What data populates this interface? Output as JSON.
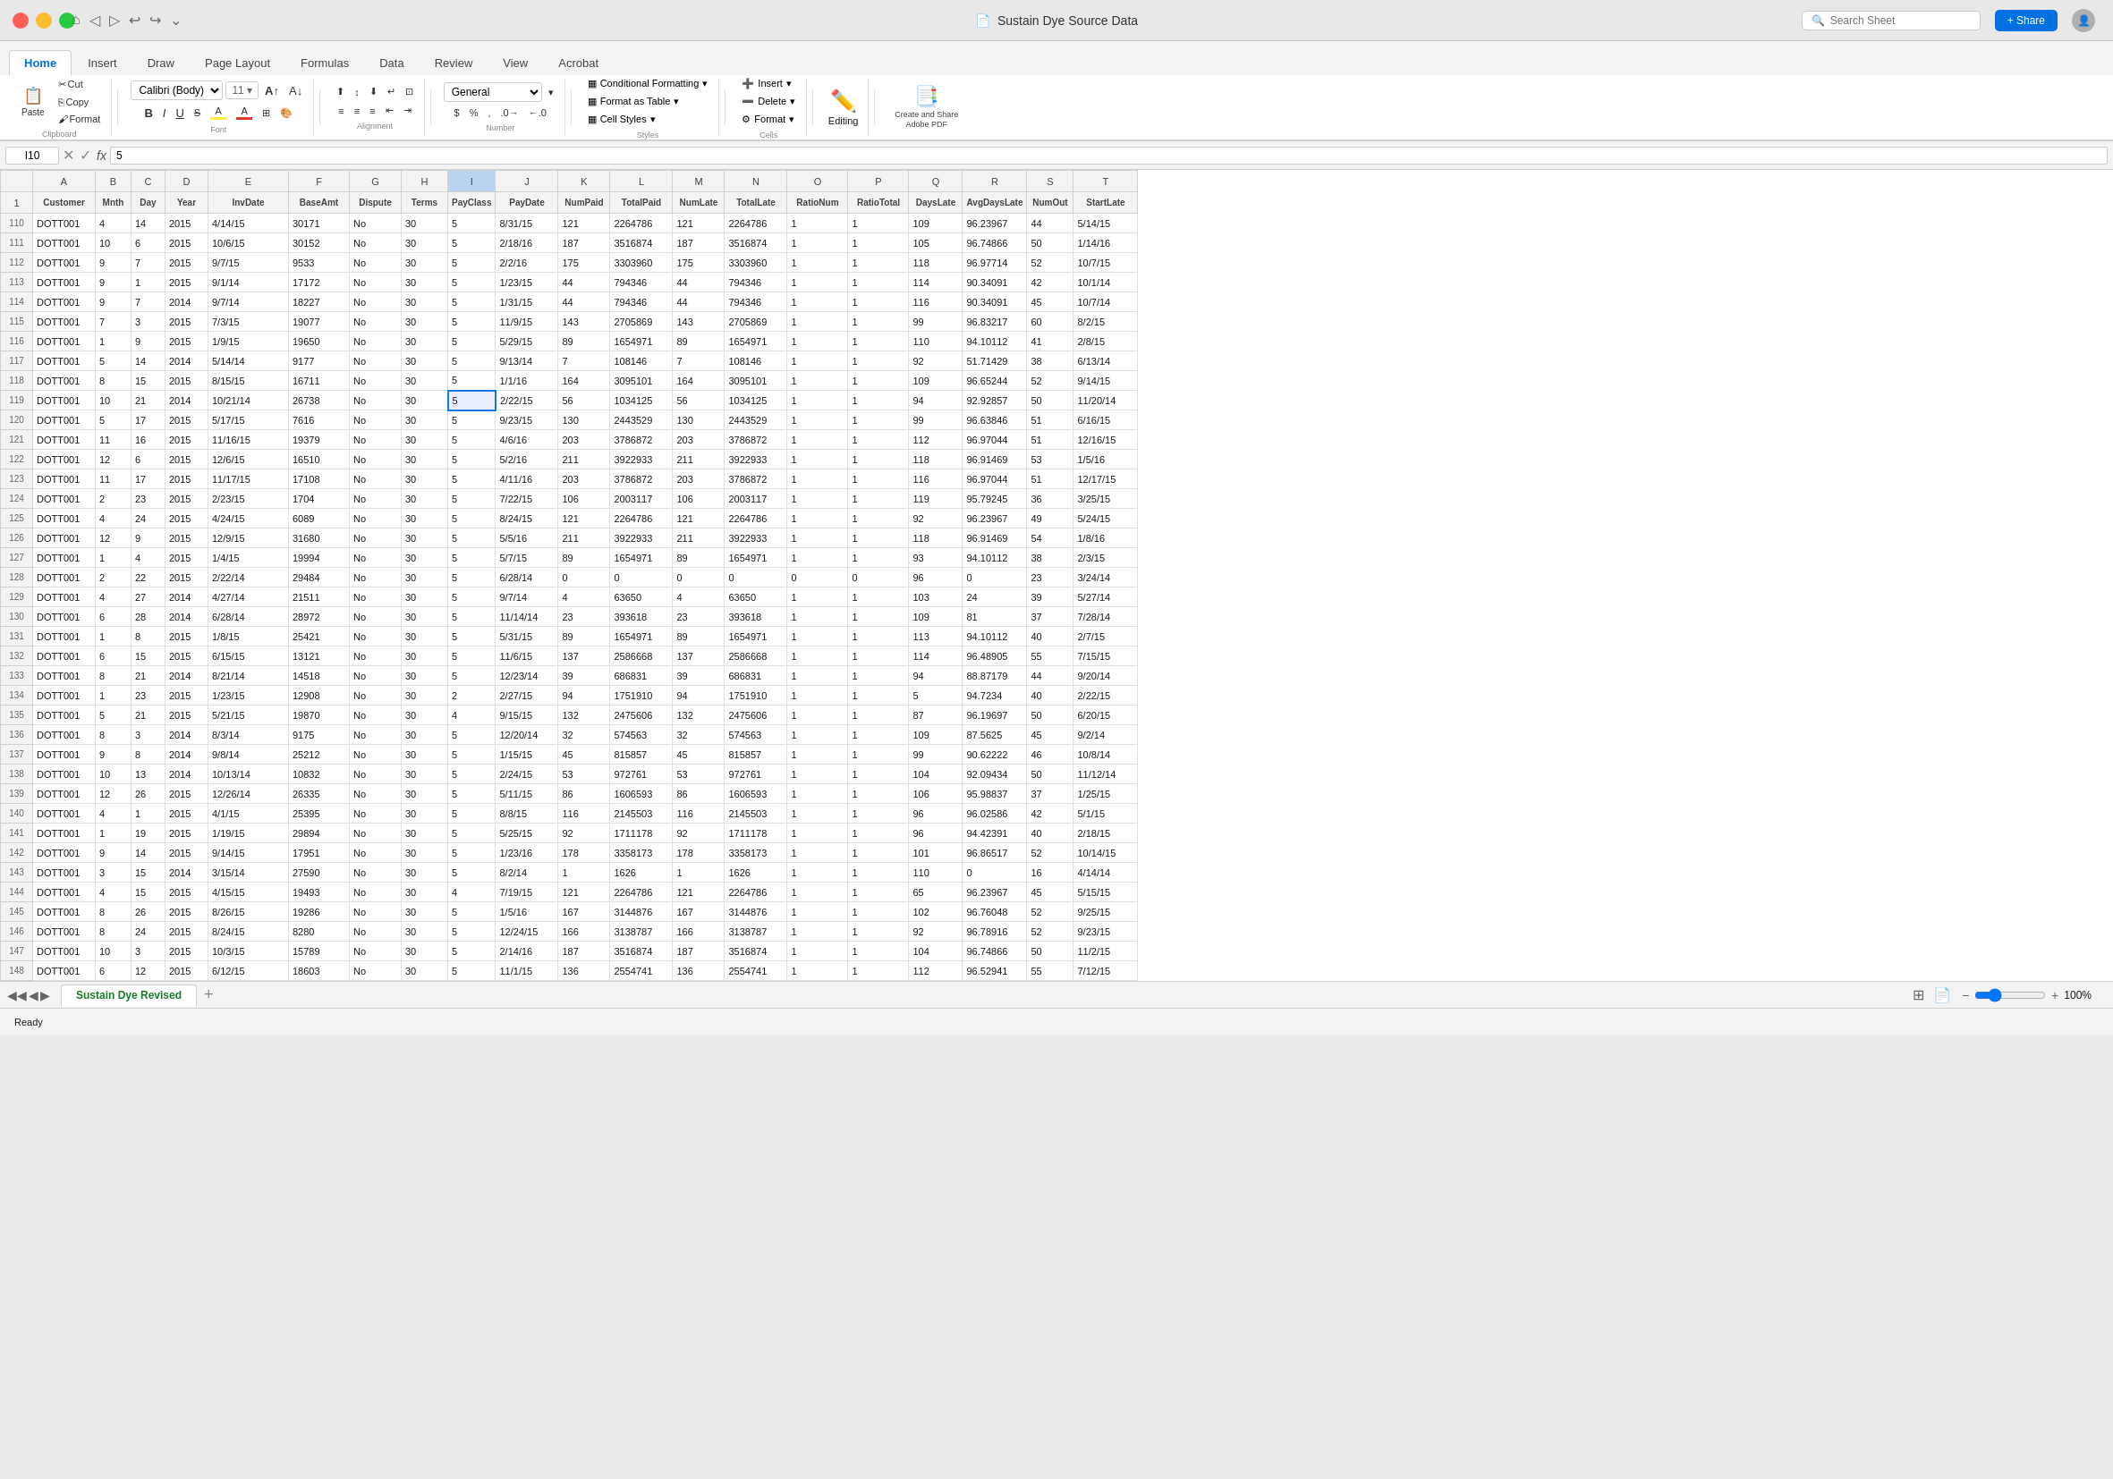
{
  "titlebar": {
    "title": "Sustain Dye Source Data",
    "file_icon": "📄"
  },
  "search": {
    "placeholder": "Search Sheet"
  },
  "share": {
    "label": "+ Share"
  },
  "tabs": [
    "Home",
    "Insert",
    "Draw",
    "Page Layout",
    "Formulas",
    "Data",
    "Review",
    "View",
    "Acrobat"
  ],
  "active_tab": "Home",
  "ribbon": {
    "clipboard": {
      "paste": "Paste",
      "cut_label": "✂",
      "copy_label": "⎘",
      "format_label": "🖌"
    },
    "font": {
      "name": "Calibri (Body)",
      "size": "11",
      "bold": "B",
      "italic": "I",
      "underline": "U"
    },
    "alignment": {
      "labels": [
        "≡",
        "≡",
        "≡",
        "⊞",
        "⊞",
        "⊞"
      ]
    },
    "number": {
      "format": "General"
    },
    "styles": {
      "conditional": "Conditional Formatting",
      "format_table": "Format as Table",
      "cell_styles": "Cell Styles"
    },
    "cells": {
      "insert": "Insert",
      "delete": "Delete",
      "format": "Format"
    },
    "editing_label": "Editing",
    "adobe_label": "Create and Share\nAdobe PDF"
  },
  "formula_bar": {
    "cell_ref": "I10",
    "formula": "5"
  },
  "columns": [
    "",
    "A",
    "B",
    "C",
    "D",
    "E",
    "F",
    "G",
    "H",
    "I",
    "J",
    "K",
    "L",
    "M",
    "N",
    "O",
    "P",
    "Q",
    "R",
    "S",
    "T"
  ],
  "column_headers": {
    "A": "Customer",
    "B": "Mnth",
    "C": "Day",
    "D": "Year",
    "E": "InvDate",
    "F": "BaseAmt",
    "G": "Dispute",
    "H": "Terms",
    "I": "PayClass",
    "J": "PayDate",
    "K": "NumPaid",
    "L": "TotalPaid",
    "M": "NumLate",
    "N": "TotalLate",
    "O": "RatioNum",
    "P": "RatioTotal",
    "Q": "DaysLate",
    "R": "AvgDaysLate",
    "S": "NumOut",
    "T": "StartLate"
  },
  "rows": [
    {
      "num": "110",
      "A": "DOTT001",
      "B": "4",
      "C": "14",
      "D": "2015",
      "E": "4/14/15",
      "F": "30171",
      "G": "No",
      "H": "30",
      "I": "5",
      "J": "8/31/15",
      "K": "121",
      "L": "2264786",
      "M": "121",
      "N": "2264786",
      "O": "1",
      "P": "1",
      "Q": "109",
      "R": "96.23967",
      "S": "44",
      "T": "5/14/15"
    },
    {
      "num": "111",
      "A": "DOTT001",
      "B": "10",
      "C": "6",
      "D": "2015",
      "E": "10/6/15",
      "F": "30152",
      "G": "No",
      "H": "30",
      "I": "5",
      "J": "2/18/16",
      "K": "187",
      "L": "3516874",
      "M": "187",
      "N": "3516874",
      "O": "1",
      "P": "1",
      "Q": "105",
      "R": "96.74866",
      "S": "50",
      "T": "1/14/16"
    },
    {
      "num": "112",
      "A": "DOTT001",
      "B": "9",
      "C": "7",
      "D": "2015",
      "E": "9/7/15",
      "F": "9533",
      "G": "No",
      "H": "30",
      "I": "5",
      "J": "2/2/16",
      "K": "175",
      "L": "3303960",
      "M": "175",
      "N": "3303960",
      "O": "1",
      "P": "1",
      "Q": "118",
      "R": "96.97714",
      "S": "52",
      "T": "10/7/15"
    },
    {
      "num": "113",
      "A": "DOTT001",
      "B": "9",
      "C": "1",
      "D": "2015",
      "E": "9/1/14",
      "F": "17172",
      "G": "No",
      "H": "30",
      "I": "5",
      "J": "1/23/15",
      "K": "44",
      "L": "794346",
      "M": "44",
      "N": "794346",
      "O": "1",
      "P": "1",
      "Q": "114",
      "R": "90.34091",
      "S": "42",
      "T": "10/1/14"
    },
    {
      "num": "114",
      "A": "DOTT001",
      "B": "9",
      "C": "7",
      "D": "2014",
      "E": "9/7/14",
      "F": "18227",
      "G": "No",
      "H": "30",
      "I": "5",
      "J": "1/31/15",
      "K": "44",
      "L": "794346",
      "M": "44",
      "N": "794346",
      "O": "1",
      "P": "1",
      "Q": "116",
      "R": "90.34091",
      "S": "45",
      "T": "10/7/14"
    },
    {
      "num": "115",
      "A": "DOTT001",
      "B": "7",
      "C": "3",
      "D": "2015",
      "E": "7/3/15",
      "F": "19077",
      "G": "No",
      "H": "30",
      "I": "5",
      "J": "11/9/15",
      "K": "143",
      "L": "2705869",
      "M": "143",
      "N": "2705869",
      "O": "1",
      "P": "1",
      "Q": "99",
      "R": "96.83217",
      "S": "60",
      "T": "8/2/15"
    },
    {
      "num": "116",
      "A": "DOTT001",
      "B": "1",
      "C": "9",
      "D": "2015",
      "E": "1/9/15",
      "F": "19650",
      "G": "No",
      "H": "30",
      "I": "5",
      "J": "5/29/15",
      "K": "89",
      "L": "1654971",
      "M": "89",
      "N": "1654971",
      "O": "1",
      "P": "1",
      "Q": "110",
      "R": "94.10112",
      "S": "41",
      "T": "2/8/15"
    },
    {
      "num": "117",
      "A": "DOTT001",
      "B": "5",
      "C": "14",
      "D": "2014",
      "E": "5/14/14",
      "F": "9177",
      "G": "No",
      "H": "30",
      "I": "5",
      "J": "9/13/14",
      "K": "7",
      "L": "108146",
      "M": "7",
      "N": "108146",
      "O": "1",
      "P": "1",
      "Q": "92",
      "R": "51.71429",
      "S": "38",
      "T": "6/13/14"
    },
    {
      "num": "118",
      "A": "DOTT001",
      "B": "8",
      "C": "15",
      "D": "2015",
      "E": "8/15/15",
      "F": "16711",
      "G": "No",
      "H": "30",
      "I": "5",
      "J": "1/1/16",
      "K": "164",
      "L": "3095101",
      "M": "164",
      "N": "3095101",
      "O": "1",
      "P": "1",
      "Q": "109",
      "R": "96.65244",
      "S": "52",
      "T": "9/14/15"
    },
    {
      "num": "119",
      "A": "DOTT001",
      "B": "10",
      "C": "21",
      "D": "2014",
      "E": "10/21/14",
      "F": "26738",
      "G": "No",
      "H": "30",
      "I": "5",
      "J": "2/22/15",
      "K": "56",
      "L": "1034125",
      "M": "56",
      "N": "1034125",
      "O": "1",
      "P": "1",
      "Q": "94",
      "R": "92.92857",
      "S": "50",
      "T": "11/20/14"
    },
    {
      "num": "120",
      "A": "DOTT001",
      "B": "5",
      "C": "17",
      "D": "2015",
      "E": "5/17/15",
      "F": "7616",
      "G": "No",
      "H": "30",
      "I": "5",
      "J": "9/23/15",
      "K": "130",
      "L": "2443529",
      "M": "130",
      "N": "2443529",
      "O": "1",
      "P": "1",
      "Q": "99",
      "R": "96.63846",
      "S": "51",
      "T": "6/16/15"
    },
    {
      "num": "121",
      "A": "DOTT001",
      "B": "11",
      "C": "16",
      "D": "2015",
      "E": "11/16/15",
      "F": "19379",
      "G": "No",
      "H": "30",
      "I": "5",
      "J": "4/6/16",
      "K": "203",
      "L": "3786872",
      "M": "203",
      "N": "3786872",
      "O": "1",
      "P": "1",
      "Q": "112",
      "R": "96.97044",
      "S": "51",
      "T": "12/16/15"
    },
    {
      "num": "122",
      "A": "DOTT001",
      "B": "12",
      "C": "6",
      "D": "2015",
      "E": "12/6/15",
      "F": "16510",
      "G": "No",
      "H": "30",
      "I": "5",
      "J": "5/2/16",
      "K": "211",
      "L": "3922933",
      "M": "211",
      "N": "3922933",
      "O": "1",
      "P": "1",
      "Q": "118",
      "R": "96.91469",
      "S": "53",
      "T": "1/5/16"
    },
    {
      "num": "123",
      "A": "DOTT001",
      "B": "11",
      "C": "17",
      "D": "2015",
      "E": "11/17/15",
      "F": "17108",
      "G": "No",
      "H": "30",
      "I": "5",
      "J": "4/11/16",
      "K": "203",
      "L": "3786872",
      "M": "203",
      "N": "3786872",
      "O": "1",
      "P": "1",
      "Q": "116",
      "R": "96.97044",
      "S": "51",
      "T": "12/17/15"
    },
    {
      "num": "124",
      "A": "DOTT001",
      "B": "2",
      "C": "23",
      "D": "2015",
      "E": "2/23/15",
      "F": "1704",
      "G": "No",
      "H": "30",
      "I": "5",
      "J": "7/22/15",
      "K": "106",
      "L": "2003117",
      "M": "106",
      "N": "2003117",
      "O": "1",
      "P": "1",
      "Q": "119",
      "R": "95.79245",
      "S": "36",
      "T": "3/25/15"
    },
    {
      "num": "125",
      "A": "DOTT001",
      "B": "4",
      "C": "24",
      "D": "2015",
      "E": "4/24/15",
      "F": "6089",
      "G": "No",
      "H": "30",
      "I": "5",
      "J": "8/24/15",
      "K": "121",
      "L": "2264786",
      "M": "121",
      "N": "2264786",
      "O": "1",
      "P": "1",
      "Q": "92",
      "R": "96.23967",
      "S": "49",
      "T": "5/24/15"
    },
    {
      "num": "126",
      "A": "DOTT001",
      "B": "12",
      "C": "9",
      "D": "2015",
      "E": "12/9/15",
      "F": "31680",
      "G": "No",
      "H": "30",
      "I": "5",
      "J": "5/5/16",
      "K": "211",
      "L": "3922933",
      "M": "211",
      "N": "3922933",
      "O": "1",
      "P": "1",
      "Q": "118",
      "R": "96.91469",
      "S": "54",
      "T": "1/8/16"
    },
    {
      "num": "127",
      "A": "DOTT001",
      "B": "1",
      "C": "4",
      "D": "2015",
      "E": "1/4/15",
      "F": "19994",
      "G": "No",
      "H": "30",
      "I": "5",
      "J": "5/7/15",
      "K": "89",
      "L": "1654971",
      "M": "89",
      "N": "1654971",
      "O": "1",
      "P": "1",
      "Q": "93",
      "R": "94.10112",
      "S": "38",
      "T": "2/3/15"
    },
    {
      "num": "128",
      "A": "DOTT001",
      "B": "2",
      "C": "22",
      "D": "2015",
      "E": "2/22/14",
      "F": "29484",
      "G": "No",
      "H": "30",
      "I": "5",
      "J": "6/28/14",
      "K": "0",
      "L": "0",
      "M": "0",
      "N": "0",
      "O": "0",
      "P": "0",
      "Q": "96",
      "R": "0",
      "S": "23",
      "T": "3/24/14"
    },
    {
      "num": "129",
      "A": "DOTT001",
      "B": "4",
      "C": "27",
      "D": "2014",
      "E": "4/27/14",
      "F": "21511",
      "G": "No",
      "H": "30",
      "I": "5",
      "J": "9/7/14",
      "K": "4",
      "L": "63650",
      "M": "4",
      "N": "63650",
      "O": "1",
      "P": "1",
      "Q": "103",
      "R": "24",
      "S": "39",
      "T": "5/27/14"
    },
    {
      "num": "130",
      "A": "DOTT001",
      "B": "6",
      "C": "28",
      "D": "2014",
      "E": "6/28/14",
      "F": "28972",
      "G": "No",
      "H": "30",
      "I": "5",
      "J": "11/14/14",
      "K": "23",
      "L": "393618",
      "M": "23",
      "N": "393618",
      "O": "1",
      "P": "1",
      "Q": "109",
      "R": "81",
      "S": "37",
      "T": "7/28/14"
    },
    {
      "num": "131",
      "A": "DOTT001",
      "B": "1",
      "C": "8",
      "D": "2015",
      "E": "1/8/15",
      "F": "25421",
      "G": "No",
      "H": "30",
      "I": "5",
      "J": "5/31/15",
      "K": "89",
      "L": "1654971",
      "M": "89",
      "N": "1654971",
      "O": "1",
      "P": "1",
      "Q": "113",
      "R": "94.10112",
      "S": "40",
      "T": "2/7/15"
    },
    {
      "num": "132",
      "A": "DOTT001",
      "B": "6",
      "C": "15",
      "D": "2015",
      "E": "6/15/15",
      "F": "13121",
      "G": "No",
      "H": "30",
      "I": "5",
      "J": "11/6/15",
      "K": "137",
      "L": "2586668",
      "M": "137",
      "N": "2586668",
      "O": "1",
      "P": "1",
      "Q": "114",
      "R": "96.48905",
      "S": "55",
      "T": "7/15/15"
    },
    {
      "num": "133",
      "A": "DOTT001",
      "B": "8",
      "C": "21",
      "D": "2014",
      "E": "8/21/14",
      "F": "14518",
      "G": "No",
      "H": "30",
      "I": "5",
      "J": "12/23/14",
      "K": "39",
      "L": "686831",
      "M": "39",
      "N": "686831",
      "O": "1",
      "P": "1",
      "Q": "94",
      "R": "88.87179",
      "S": "44",
      "T": "9/20/14"
    },
    {
      "num": "134",
      "A": "DOTT001",
      "B": "1",
      "C": "23",
      "D": "2015",
      "E": "1/23/15",
      "F": "12908",
      "G": "No",
      "H": "30",
      "I": "2",
      "J": "2/27/15",
      "K": "94",
      "L": "1751910",
      "M": "94",
      "N": "1751910",
      "O": "1",
      "P": "1",
      "Q": "5",
      "R": "94.7234",
      "S": "40",
      "T": "2/22/15"
    },
    {
      "num": "135",
      "A": "DOTT001",
      "B": "5",
      "C": "21",
      "D": "2015",
      "E": "5/21/15",
      "F": "19870",
      "G": "No",
      "H": "30",
      "I": "4",
      "J": "9/15/15",
      "K": "132",
      "L": "2475606",
      "M": "132",
      "N": "2475606",
      "O": "1",
      "P": "1",
      "Q": "87",
      "R": "96.19697",
      "S": "50",
      "T": "6/20/15"
    },
    {
      "num": "136",
      "A": "DOTT001",
      "B": "8",
      "C": "3",
      "D": "2014",
      "E": "8/3/14",
      "F": "9175",
      "G": "No",
      "H": "30",
      "I": "5",
      "J": "12/20/14",
      "K": "32",
      "L": "574563",
      "M": "32",
      "N": "574563",
      "O": "1",
      "P": "1",
      "Q": "109",
      "R": "87.5625",
      "S": "45",
      "T": "9/2/14"
    },
    {
      "num": "137",
      "A": "DOTT001",
      "B": "9",
      "C": "8",
      "D": "2014",
      "E": "9/8/14",
      "F": "25212",
      "G": "No",
      "H": "30",
      "I": "5",
      "J": "1/15/15",
      "K": "45",
      "L": "815857",
      "M": "45",
      "N": "815857",
      "O": "1",
      "P": "1",
      "Q": "99",
      "R": "90.62222",
      "S": "46",
      "T": "10/8/14"
    },
    {
      "num": "138",
      "A": "DOTT001",
      "B": "10",
      "C": "13",
      "D": "2014",
      "E": "10/13/14",
      "F": "10832",
      "G": "No",
      "H": "30",
      "I": "5",
      "J": "2/24/15",
      "K": "53",
      "L": "972761",
      "M": "53",
      "N": "972761",
      "O": "1",
      "P": "1",
      "Q": "104",
      "R": "92.09434",
      "S": "50",
      "T": "11/12/14"
    },
    {
      "num": "139",
      "A": "DOTT001",
      "B": "12",
      "C": "26",
      "D": "2015",
      "E": "12/26/14",
      "F": "26335",
      "G": "No",
      "H": "30",
      "I": "5",
      "J": "5/11/15",
      "K": "86",
      "L": "1606593",
      "M": "86",
      "N": "1606593",
      "O": "1",
      "P": "1",
      "Q": "106",
      "R": "95.98837",
      "S": "37",
      "T": "1/25/15"
    },
    {
      "num": "140",
      "A": "DOTT001",
      "B": "4",
      "C": "1",
      "D": "2015",
      "E": "4/1/15",
      "F": "25395",
      "G": "No",
      "H": "30",
      "I": "5",
      "J": "8/8/15",
      "K": "116",
      "L": "2145503",
      "M": "116",
      "N": "2145503",
      "O": "1",
      "P": "1",
      "Q": "96",
      "R": "96.02586",
      "S": "42",
      "T": "5/1/15"
    },
    {
      "num": "141",
      "A": "DOTT001",
      "B": "1",
      "C": "19",
      "D": "2015",
      "E": "1/19/15",
      "F": "29894",
      "G": "No",
      "H": "30",
      "I": "5",
      "J": "5/25/15",
      "K": "92",
      "L": "1711178",
      "M": "92",
      "N": "1711178",
      "O": "1",
      "P": "1",
      "Q": "96",
      "R": "94.42391",
      "S": "40",
      "T": "2/18/15"
    },
    {
      "num": "142",
      "A": "DOTT001",
      "B": "9",
      "C": "14",
      "D": "2015",
      "E": "9/14/15",
      "F": "17951",
      "G": "No",
      "H": "30",
      "I": "5",
      "J": "1/23/16",
      "K": "178",
      "L": "3358173",
      "M": "178",
      "N": "3358173",
      "O": "1",
      "P": "1",
      "Q": "101",
      "R": "96.86517",
      "S": "52",
      "T": "10/14/15"
    },
    {
      "num": "143",
      "A": "DOTT001",
      "B": "3",
      "C": "15",
      "D": "2014",
      "E": "3/15/14",
      "F": "27590",
      "G": "No",
      "H": "30",
      "I": "5",
      "J": "8/2/14",
      "K": "1",
      "L": "1626",
      "M": "1",
      "N": "1626",
      "O": "1",
      "P": "1",
      "Q": "110",
      "R": "0",
      "S": "16",
      "T": "4/14/14"
    },
    {
      "num": "144",
      "A": "DOTT001",
      "B": "4",
      "C": "15",
      "D": "2015",
      "E": "4/15/15",
      "F": "19493",
      "G": "No",
      "H": "30",
      "I": "4",
      "J": "7/19/15",
      "K": "121",
      "L": "2264786",
      "M": "121",
      "N": "2264786",
      "O": "1",
      "P": "1",
      "Q": "65",
      "R": "96.23967",
      "S": "45",
      "T": "5/15/15"
    },
    {
      "num": "145",
      "A": "DOTT001",
      "B": "8",
      "C": "26",
      "D": "2015",
      "E": "8/26/15",
      "F": "19286",
      "G": "No",
      "H": "30",
      "I": "5",
      "J": "1/5/16",
      "K": "167",
      "L": "3144876",
      "M": "167",
      "N": "3144876",
      "O": "1",
      "P": "1",
      "Q": "102",
      "R": "96.76048",
      "S": "52",
      "T": "9/25/15"
    },
    {
      "num": "146",
      "A": "DOTT001",
      "B": "8",
      "C": "24",
      "D": "2015",
      "E": "8/24/15",
      "F": "8280",
      "G": "No",
      "H": "30",
      "I": "5",
      "J": "12/24/15",
      "K": "166",
      "L": "3138787",
      "M": "166",
      "N": "3138787",
      "O": "1",
      "P": "1",
      "Q": "92",
      "R": "96.78916",
      "S": "52",
      "T": "9/23/15"
    },
    {
      "num": "147",
      "A": "DOTT001",
      "B": "10",
      "C": "3",
      "D": "2015",
      "E": "10/3/15",
      "F": "15789",
      "G": "No",
      "H": "30",
      "I": "5",
      "J": "2/14/16",
      "K": "187",
      "L": "3516874",
      "M": "187",
      "N": "3516874",
      "O": "1",
      "P": "1",
      "Q": "104",
      "R": "96.74866",
      "S": "50",
      "T": "11/2/15"
    },
    {
      "num": "148",
      "A": "DOTT001",
      "B": "6",
      "C": "12",
      "D": "2015",
      "E": "6/12/15",
      "F": "18603",
      "G": "No",
      "H": "30",
      "I": "5",
      "J": "11/1/15",
      "K": "136",
      "L": "2554741",
      "M": "136",
      "N": "2554741",
      "O": "1",
      "P": "1",
      "Q": "112",
      "R": "96.52941",
      "S": "55",
      "T": "7/12/15"
    }
  ],
  "sheet_tab": {
    "name": "Sustain Dye Revised"
  },
  "status": {
    "ready": "Ready"
  },
  "zoom": {
    "level": "100%"
  }
}
